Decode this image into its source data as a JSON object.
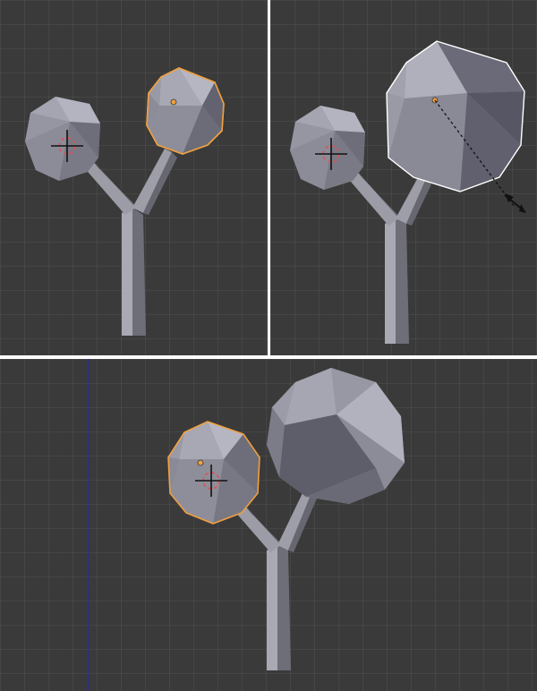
{
  "colors": {
    "viewport_background": "#3a3a3a",
    "selection_outline": "#f0a040",
    "active_outline": "#ffffff",
    "mesh_light": "#a6a6b2",
    "mesh_mid": "#8a8a96",
    "mesh_dark": "#5e5e68",
    "view_axis_line": "#2d2d8c"
  },
  "viewports": [
    {
      "name": "top-left",
      "state": "small sphere selected"
    },
    {
      "name": "top-right",
      "state": "scaling sphere"
    },
    {
      "name": "bottom",
      "state": "result"
    }
  ],
  "icons": [
    "3d-cursor-icon",
    "object-origin-icon",
    "scale-arrow-icon"
  ]
}
